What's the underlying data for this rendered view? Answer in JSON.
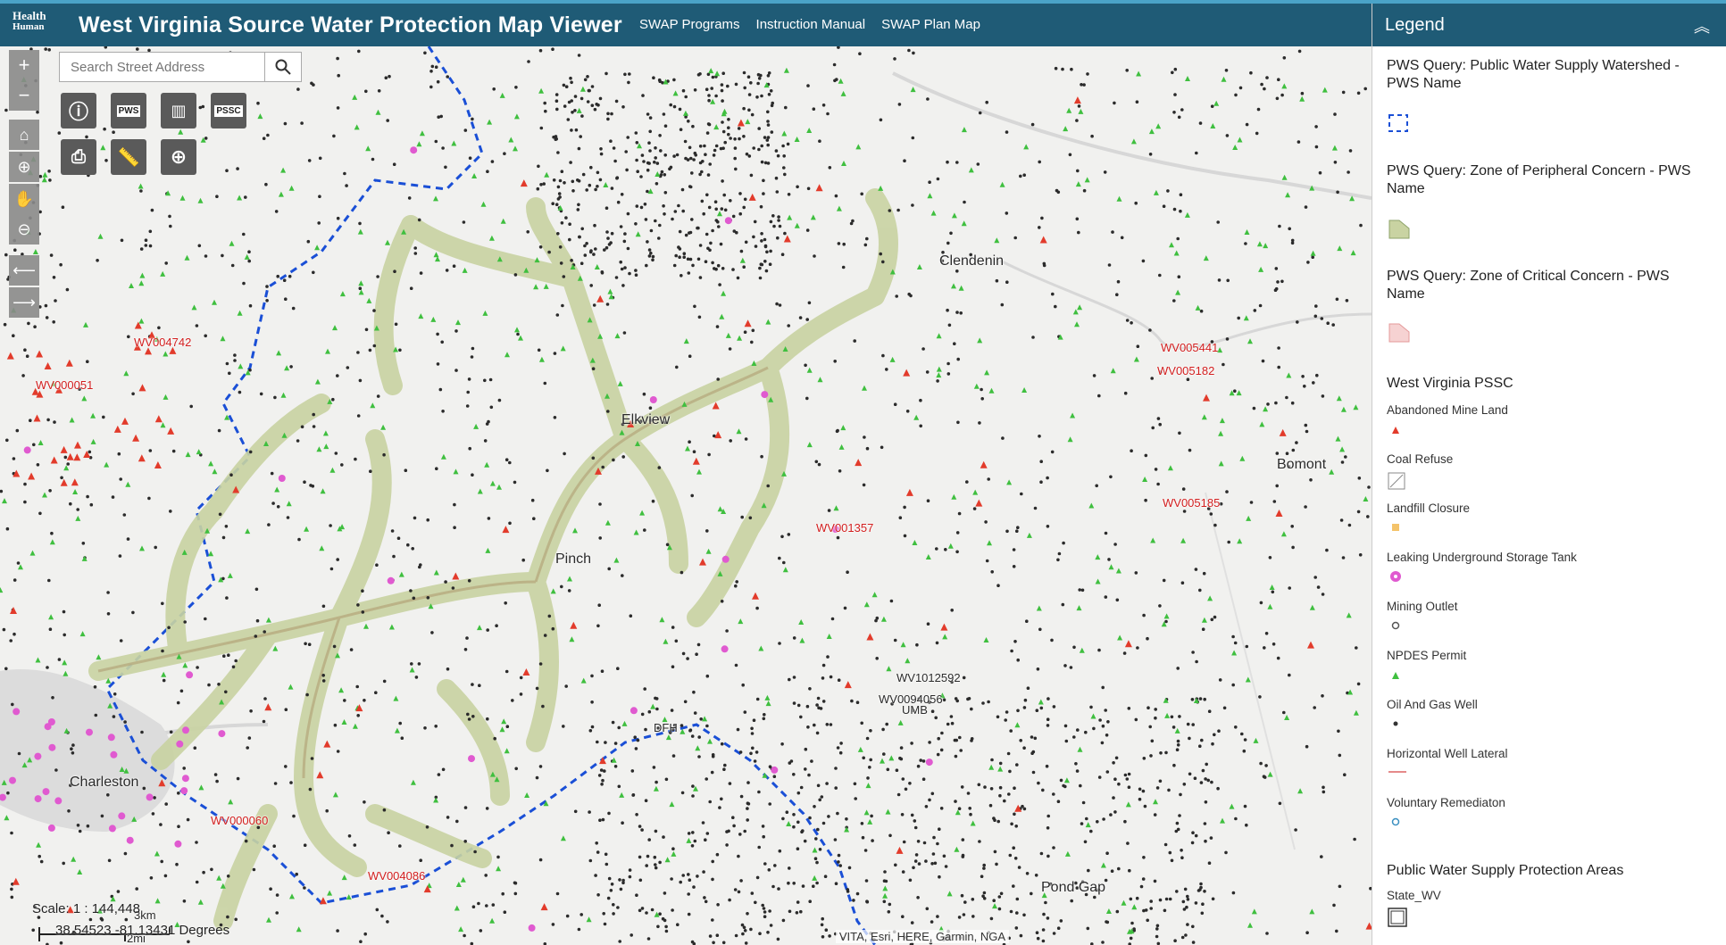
{
  "header": {
    "logo_line1": "Health",
    "logo_line2": "Human",
    "title": "West Virginia Source Water Protection Map Viewer",
    "nav": [
      "SWAP Programs",
      "Instruction Manual",
      "SWAP Plan Map"
    ]
  },
  "search": {
    "placeholder": "Search Street Address"
  },
  "toolbar": {
    "buttons": [
      "info-icon",
      "pws-icon",
      "map-icon",
      "pssc-icon",
      "print-icon",
      "measure-icon",
      "locate-icon"
    ],
    "pws_label": "PWS",
    "pssc_label": "PSSC"
  },
  "map": {
    "places": [
      "Clendenin",
      "Elkview",
      "Pinch",
      "Charleston",
      "Bomont",
      "Pond Gap"
    ],
    "accent_colors": {
      "npdes": "#3fbf3f",
      "abandoned_mine": "#e23b2b",
      "oil_gas": "#222222",
      "lust": "#e05ad0",
      "watershed": "#1a4fd6",
      "zone_peripheral": "#c9d3a2"
    },
    "sample_labels": [
      "WV004742",
      "WV000051",
      "WV005441",
      "WV005182",
      "WV000060",
      "WV004086",
      "WV001357",
      "WV1012592",
      "WV0094056",
      "UMB",
      "DFH",
      "WV005185"
    ]
  },
  "scale": {
    "km": "3km",
    "mi": "2mi",
    "text": "Scale: 1 : 144,448"
  },
  "coords": "38.54523 -81.13431 Degrees",
  "attribution": "VITA, Esri, HERE, Garmin, NGA",
  "legend": {
    "title": "Legend",
    "collapse": "︽",
    "sections": [
      "PWS Query: Public Water Supply Watershed - PWS Name",
      "PWS Query: Zone of Peripheral Concern - PWS Name",
      "PWS Query: Zone of Critical Concern - PWS Name",
      "West Virginia PSSC",
      "Public Water Supply Protection Areas"
    ],
    "items": [
      "Abandoned Mine Land",
      "Coal Refuse",
      "Landfill Closure",
      "Leaking Underground Storage Tank",
      "Mining Outlet",
      "NPDES Permit",
      "Oil And Gas Well",
      "Horizontal Well Lateral",
      "Voluntary Remediaton",
      "State_WV"
    ]
  }
}
